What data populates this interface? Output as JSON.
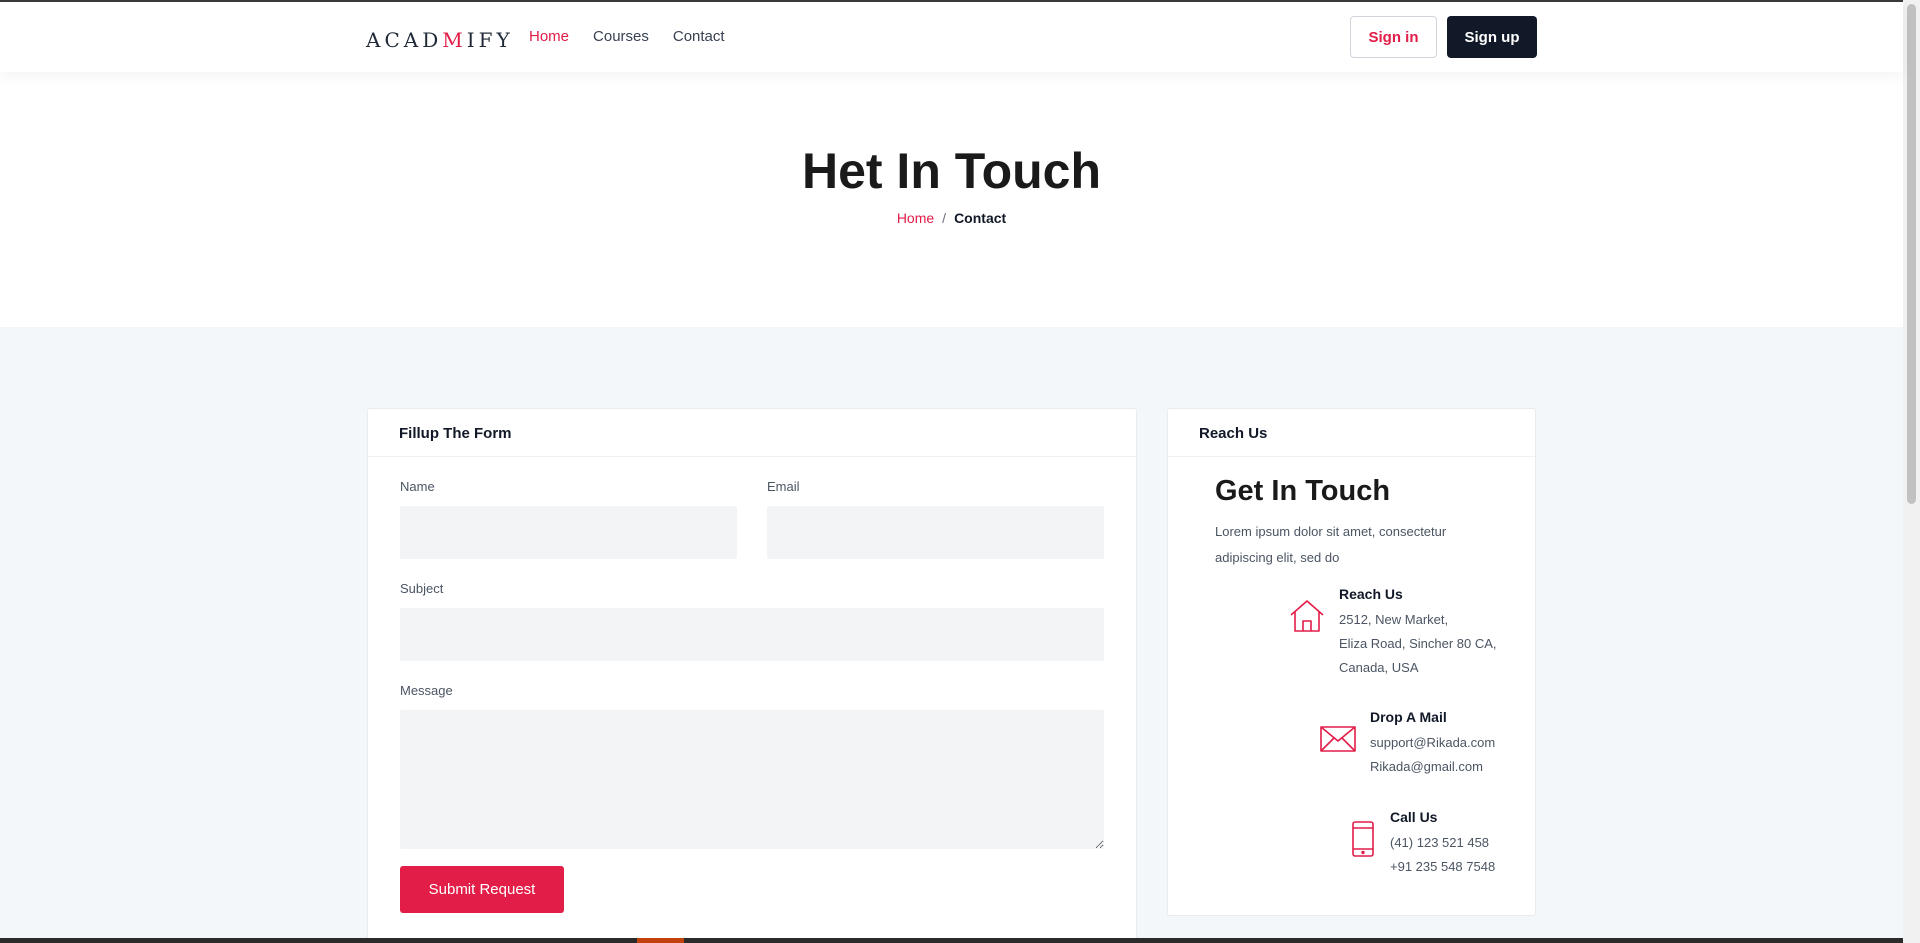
{
  "header": {
    "logo": {
      "part1": "ACAD",
      "part2": "M",
      "part3": "IFY"
    },
    "nav": [
      {
        "label": "Home",
        "active": true
      },
      {
        "label": "Courses",
        "active": false
      },
      {
        "label": "Contact",
        "active": false
      }
    ],
    "signin_label": "Sign in",
    "signup_label": "Sign up"
  },
  "hero": {
    "title": "Het In Touch",
    "breadcrumb": {
      "home": "Home",
      "separator": "/",
      "current": "Contact"
    }
  },
  "form": {
    "heading": "Fillup The Form",
    "name_label": "Name",
    "name_value": "",
    "email_label": "Email",
    "email_value": "",
    "subject_label": "Subject",
    "subject_value": "",
    "message_label": "Message",
    "message_value": "",
    "submit_label": "Submit Request"
  },
  "reach": {
    "heading": "Reach Us",
    "title": "Get In Touch",
    "description": "Lorem ipsum dolor sit amet, consectetur adipiscing elit, sed do",
    "address": {
      "title": "Reach Us",
      "lines": [
        "2512, New Market,",
        "Eliza Road, Sincher 80 CA,",
        "Canada, USA"
      ],
      "icon": "home-icon"
    },
    "mail": {
      "title": "Drop A Mail",
      "lines": [
        "support@Rikada.com",
        "Rikada@gmail.com"
      ],
      "icon": "mail-icon"
    },
    "phone": {
      "title": "Call Us",
      "lines": [
        "(41) 123 521 458",
        "+91 235 548 7548"
      ],
      "icon": "phone-icon"
    }
  },
  "colors": {
    "accent": "#e11d48",
    "dark": "#111827",
    "section_bg": "#f4f7f9"
  }
}
